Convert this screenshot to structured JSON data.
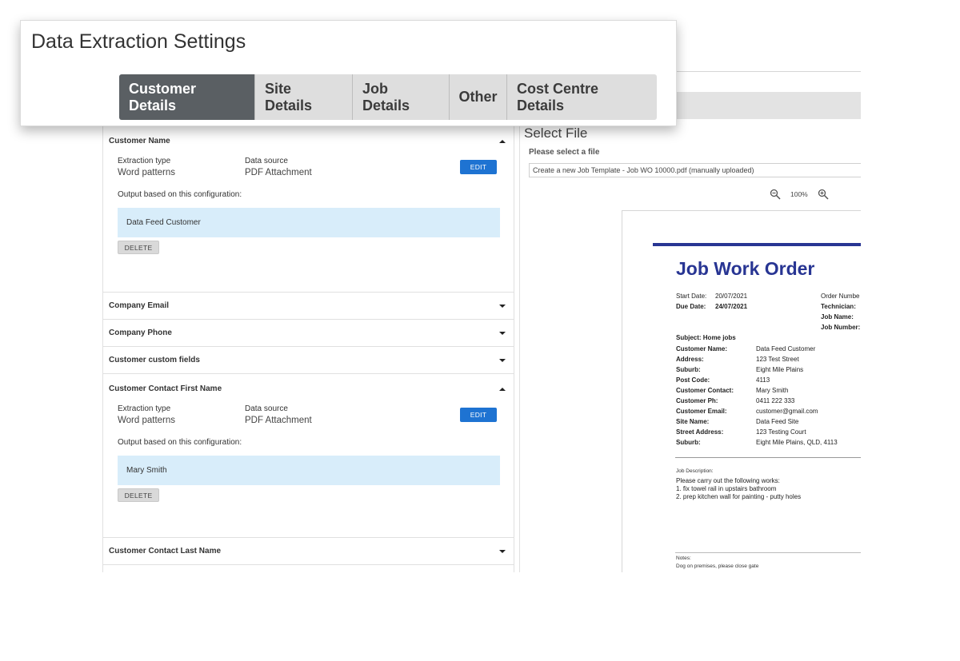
{
  "settings": {
    "title": "Data Extraction Settings",
    "tabs": [
      "Customer Details",
      "Site Details",
      "Job Details",
      "Other",
      "Cost Centre Details"
    ],
    "active_tab": "Customer Details"
  },
  "sections": {
    "customer_name": {
      "title": "Customer Name",
      "extraction_type_label": "Extraction type",
      "extraction_type": "Word patterns",
      "data_source_label": "Data source",
      "data_source": "PDF Attachment",
      "edit_label": "EDIT",
      "output_label": "Output based on this configuration:",
      "output_value": "Data Feed Customer",
      "delete_label": "DELETE"
    },
    "company_email": {
      "title": "Company Email"
    },
    "company_phone": {
      "title": "Company Phone"
    },
    "customer_custom_fields": {
      "title": "Customer custom fields"
    },
    "contact_first_name": {
      "title": "Customer Contact First Name",
      "extraction_type_label": "Extraction type",
      "extraction_type": "Word patterns",
      "data_source_label": "Data source",
      "data_source": "PDF Attachment",
      "edit_label": "EDIT",
      "output_label": "Output based on this configuration:",
      "output_value": "Mary Smith",
      "delete_label": "DELETE"
    },
    "contact_last_name": {
      "title": "Customer Contact Last Name"
    }
  },
  "file_panel": {
    "title": "Select File",
    "select_label": "Please select a file",
    "selected_file": "Create a new Job Template - Job WO 10000.pdf (manually uploaded)",
    "zoom": "100%"
  },
  "document": {
    "title": "Job Work Order",
    "start_date_label": "Start Date:",
    "start_date": "20/07/2021",
    "due_date_label": "Due Date:",
    "due_date": "24/07/2021",
    "order_number_label": "Order Numbe",
    "technician_label": "Technician:",
    "job_name_label": "Job Name:",
    "job_number_label": "Job Number:",
    "subject": "Subject: Home jobs",
    "fields": [
      {
        "k": "Customer Name:",
        "v": "Data Feed Customer"
      },
      {
        "k": "Address:",
        "v": "123 Test Street"
      },
      {
        "k": "Suburb:",
        "v": "Eight Mile Plains"
      },
      {
        "k": "Post Code:",
        "v": "4113"
      },
      {
        "k": "Customer Contact:",
        "v": "Mary Smith"
      },
      {
        "k": "Customer Ph:",
        "v": "0411 222 333"
      },
      {
        "k": "Customer Email:",
        "v": "customer@gmail.com"
      },
      {
        "k": "Site Name:",
        "v": "Data Feed Site"
      },
      {
        "k": "Street Address:",
        "v": "123 Testing Court"
      },
      {
        "k": "Suburb:",
        "v": "Eight Mile Plains, QLD, 4113"
      }
    ],
    "job_desc_label": "Job Description:",
    "job_desc_lines": [
      "Please carry out the following works:",
      "1. fix towel rail in upstairs bathroom",
      "2. prep kitchen wall for painting - putty holes"
    ],
    "notes_label": "Notes:",
    "notes": "Dog on premises, please close gate"
  },
  "colors": {
    "accent": "#1e73d2",
    "active_tab": "#5a5f63",
    "output_bg": "#d8edfa",
    "doc_title": "#283593"
  }
}
